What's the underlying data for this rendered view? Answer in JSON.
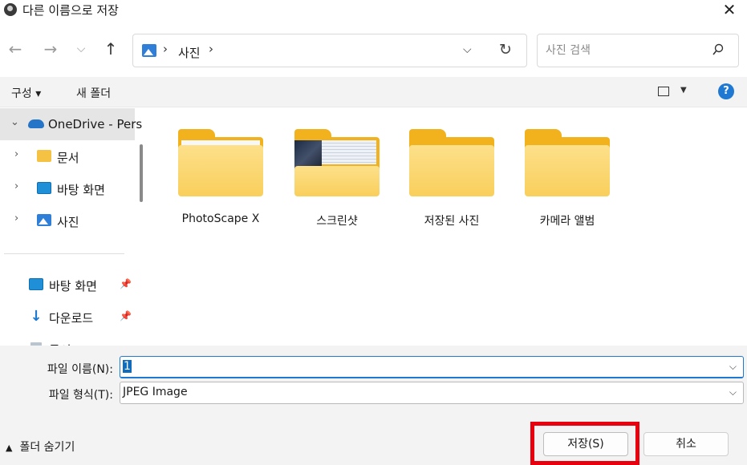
{
  "window": {
    "title": "다른 이름으로 저장",
    "close_glyph": "✕"
  },
  "nav": {
    "back_glyph": "←",
    "forward_glyph": "→",
    "recent_glyph": "⌵",
    "up_glyph": "↑",
    "breadcrumb": "사진",
    "breadcrumb_sep": "›",
    "dropdown_glyph": "⌵",
    "refresh_glyph": "↻"
  },
  "search": {
    "placeholder": "사진 검색"
  },
  "toolbar": {
    "organize": "구성 ▾",
    "new_folder": "새 폴더",
    "help": "?"
  },
  "sidebar": {
    "items": [
      {
        "label": "OneDrive - Pers",
        "icon": "cloud-icon"
      },
      {
        "label": "문서",
        "icon": "folder-icon"
      },
      {
        "label": "바탕 화면",
        "icon": "desktop-icon"
      },
      {
        "label": "사진",
        "icon": "pictures-icon"
      },
      {
        "label": "바탕 화면",
        "icon": "desktop-icon"
      },
      {
        "label": "다운로드",
        "icon": "download-icon"
      },
      {
        "label": "문서",
        "icon": "document-icon"
      }
    ]
  },
  "folders": [
    {
      "name": "PhotoScape X"
    },
    {
      "name": "스크린샷"
    },
    {
      "name": "저장된 사진"
    },
    {
      "name": "카메라 앨범"
    }
  ],
  "form": {
    "filename_label": "파일 이름(N):",
    "filename_value": "1",
    "filetype_label": "파일 형식(T):",
    "filetype_value": "JPEG Image"
  },
  "footer": {
    "hide_folders": "폴더 숨기기",
    "save": "저장(S)",
    "cancel": "취소"
  },
  "colors": {
    "accent": "#1f78d1",
    "highlight": "#e8000f",
    "folder": "#f2b21e"
  }
}
